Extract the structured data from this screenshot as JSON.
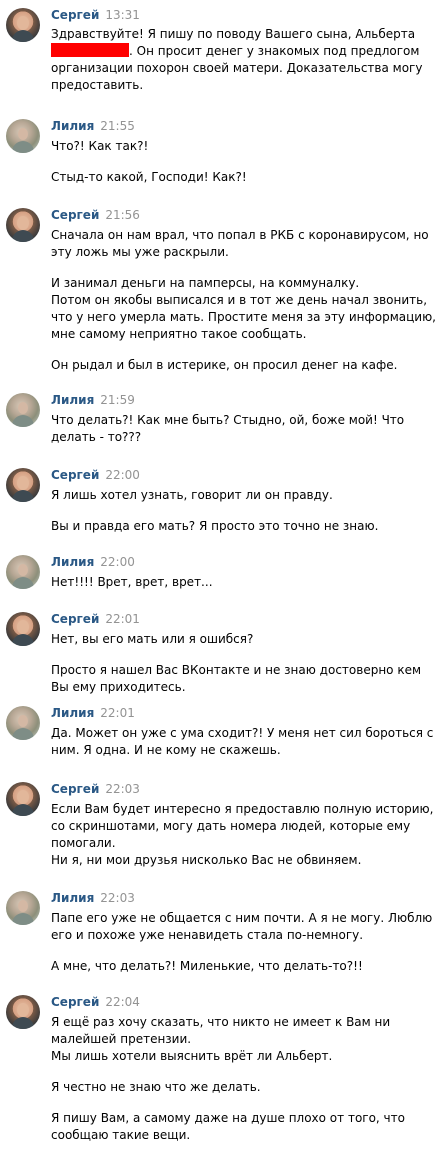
{
  "messages": [
    {
      "author": "Сергей",
      "time": "13:31",
      "avatar": "sergey",
      "paragraphs": [
        "Здравствуйте! Я пишу по поводу Вашего сына, Альберта",
        ". Он просит денег у знакомых под предлогом организации похорон своей матери. Доказательства могу предоставить."
      ]
    },
    {
      "author": "Лилия",
      "time": "21:55",
      "avatar": "liliya",
      "paragraphs": [
        "Что?! Как так?!",
        "Стыд-то какой, Господи! Как?!"
      ]
    },
    {
      "author": "Сергей",
      "time": "21:56",
      "avatar": "sergey",
      "paragraphs": [
        "Сначала он нам врал, что попал в РКБ с коронавирусом, но эту ложь мы уже раскрыли.",
        "И занимал деньги на памперсы, на коммуналку.\nПотом он якобы выписался и в тот же день начал звонить, что у него умерла мать. Простите меня за эту информацию, мне самому неприятно такое сообщать.",
        "Он рыдал и был в истерике, он просил денег на кафе."
      ]
    },
    {
      "author": "Лилия",
      "time": "21:59",
      "avatar": "liliya",
      "paragraphs": [
        "Что делать?! Как мне быть? Стыдно, ой, боже мой! Что делать - то???"
      ]
    },
    {
      "author": "Сергей",
      "time": "22:00",
      "avatar": "sergey",
      "paragraphs": [
        "Я лишь хотел узнать, говорит ли он правду.",
        "Вы и правда его мать? Я просто это точно не знаю."
      ]
    },
    {
      "author": "Лилия",
      "time": "22:00",
      "avatar": "liliya",
      "paragraphs": [
        "Нет!!!! Врет, врет, врет..."
      ]
    },
    {
      "author": "Сергей",
      "time": "22:01",
      "avatar": "sergey",
      "paragraphs": [
        "Нет, вы его мать или я ошибся?",
        "Просто я нашел Вас ВКонтакте и не знаю достоверно кем Вы ему приходитесь."
      ]
    },
    {
      "author": "Лилия",
      "time": "22:01",
      "avatar": "liliya",
      "paragraphs": [
        "Да. Может он уже с ума сходит?! У меня нет сил бороться с ним. Я одна. И не кому не скажешь."
      ]
    },
    {
      "author": "Сергей",
      "time": "22:03",
      "avatar": "sergey",
      "paragraphs": [
        "Если Вам будет интересно я предоставлю полную историю, со скриншотами, могу дать номера людей, которые ему помогали.\nНи я, ни мои друзья нисколько Вас не обвиняем."
      ]
    },
    {
      "author": "Лилия",
      "time": "22:03",
      "avatar": "liliya",
      "paragraphs": [
        "Папе его уже не общается с ним почти. А я не могу. Люблю его и похоже уже ненавидеть стала по-немногу.",
        "А мне, что делать?! Миленькие, что делать-то?!!"
      ]
    },
    {
      "author": "Сергей",
      "time": "22:04",
      "avatar": "sergey",
      "paragraphs": [
        "Я ещё раз хочу сказать, что никто не имеет к Вам ни малейшей претензии.\nМы лишь хотели выяснить врёт ли Альберт.",
        "Я честно не знаю что же делать.",
        "Я пишу Вам, а самому даже на душе плохо от того, что сообщаю такие вещи."
      ]
    }
  ]
}
